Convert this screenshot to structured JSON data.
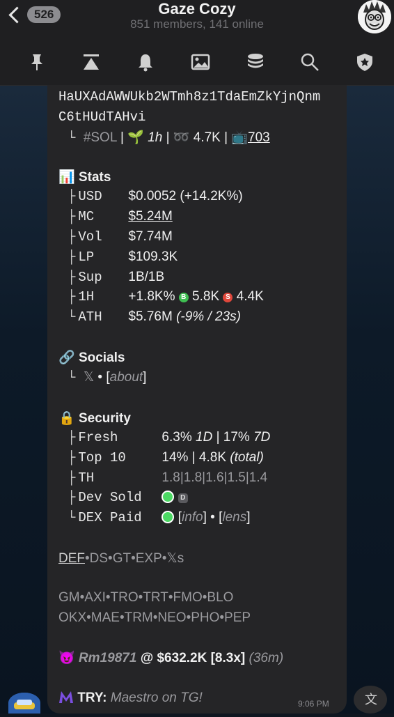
{
  "header": {
    "back_count": "526",
    "title": "Gaze Cozy",
    "subtitle": "851 members, 141 online"
  },
  "toolbar": {
    "icons": [
      "pin-icon",
      "scroll-top-icon",
      "bell-icon",
      "image-icon",
      "stack-icon",
      "search-icon",
      "shield-icon"
    ]
  },
  "message": {
    "address_line1": "HaUXAdAWWUkb2WTmh8z1TdaEmZkYjnQnm",
    "address_line2": "C6tHUdTAHvi",
    "meta": {
      "chain": "#SOL",
      "age": "1h",
      "views": "4.7K",
      "tv": "703"
    },
    "stats": {
      "heading": "Stats",
      "rows": [
        {
          "label": "USD",
          "value": "$0.0052",
          "extra": "(+14.2K%)"
        },
        {
          "label": "MC",
          "value": "$5.24M"
        },
        {
          "label": "Vol",
          "value": "$7.74M"
        },
        {
          "label": "LP",
          "value": "$109.3K"
        },
        {
          "label": "Sup",
          "value": "1B/1B"
        },
        {
          "label": "1H",
          "value": "+1.8K%",
          "buys": "5.8K",
          "sells": "4.4K"
        },
        {
          "label": "ATH",
          "value": "$5.76M",
          "extra": "(-9% / 23s)"
        }
      ]
    },
    "socials": {
      "heading": "Socials",
      "x": "𝕏",
      "sep": "•",
      "about": "about"
    },
    "security": {
      "heading": "Security",
      "fresh_label": "Fresh",
      "fresh_value": "6.3%",
      "fresh_1d": "1D",
      "fresh_value2": "17%",
      "fresh_7d": "7D",
      "top10_label": "Top 10",
      "top10_value": "14% | 4.8K",
      "top10_extra": "(total)",
      "th_label": "TH",
      "th_value": "1.8|1.8|1.6|1.5|1.4",
      "dev_label": "Dev Sold",
      "dev_badge": "D",
      "dex_label": "DEX Paid",
      "dex_info": "info",
      "dex_lens": "lens"
    },
    "links1": "DEF•DS•GT•EXP•𝕏s",
    "links1_underlined": "DEF",
    "links2": "GM•AXI•TRO•TRT•FMO•BLO",
    "links3": "OKX•MAE•TRM•NEO•PHO•PEP",
    "caller": {
      "name": "Rm19871",
      "at": "@ $632.2K [8.3x]",
      "ago": "(36m)"
    },
    "try": {
      "label": "TRY:",
      "text": "Maestro on TG!"
    },
    "time": "9:06 PM"
  },
  "colors": {
    "accent_green": "#4cd964",
    "sell_red": "#e0473b",
    "buy_green": "#3fbf52"
  }
}
